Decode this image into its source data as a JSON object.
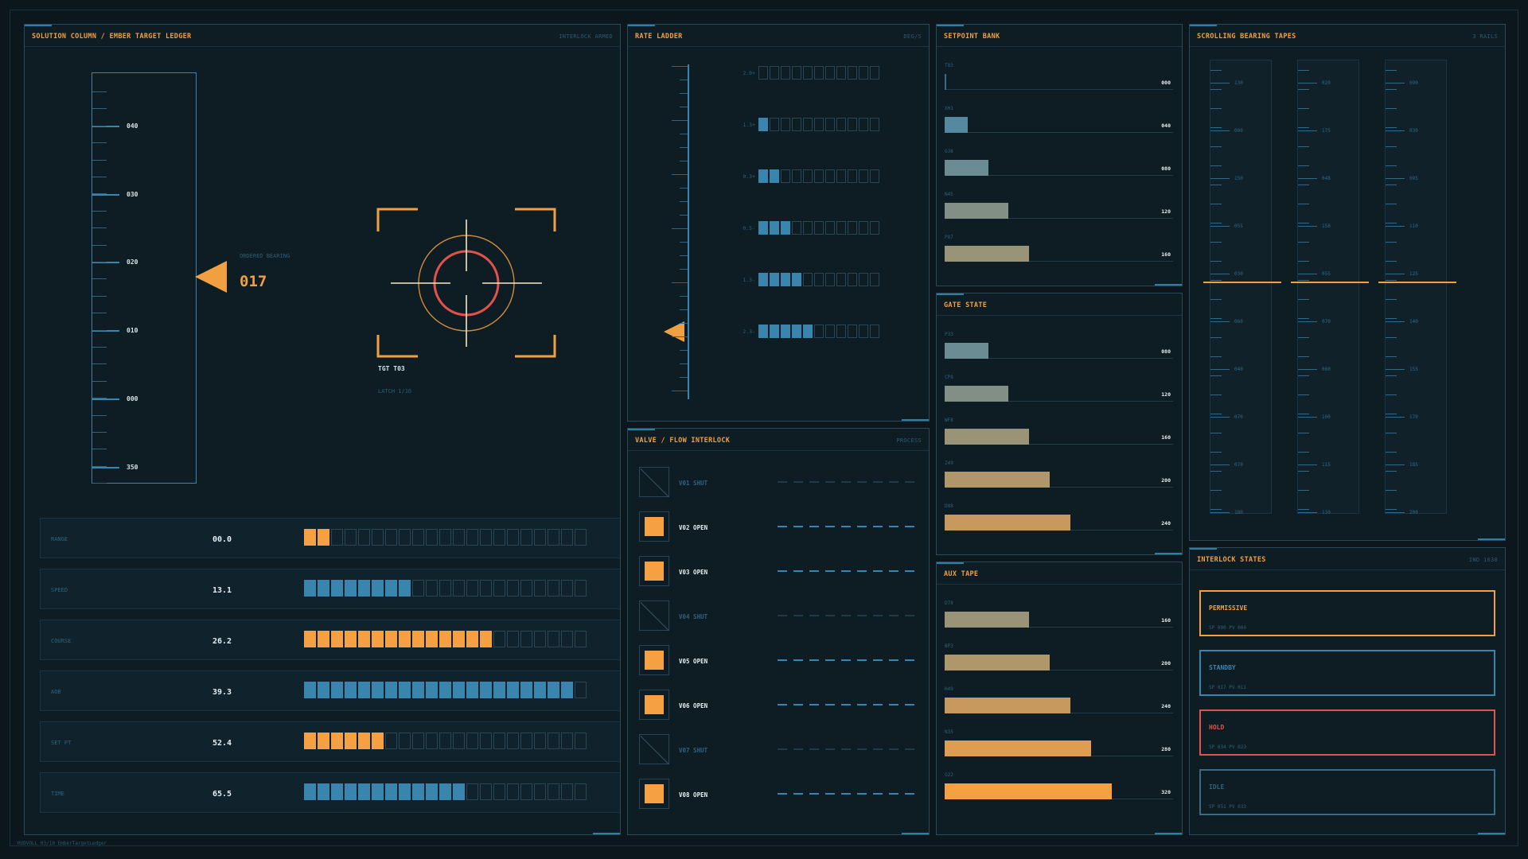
{
  "colors": {
    "accent": "#f0a040",
    "blue": "#3a85ad",
    "red": "#e0524a",
    "bg": "#0b171d"
  },
  "solution": {
    "title": "SOLUTION COLUMN / EMBER TARGET LEDGER",
    "status": "INTERLOCK ARMED",
    "tape_labels": [
      "040",
      "030",
      "020",
      "010",
      "000",
      "350"
    ],
    "ordered_bearing_label": "ORDERED BEARING",
    "ordered_bearing_value": "017",
    "target_label": "TGT T03",
    "latch_label": "LATCH 1/10",
    "metrics": [
      {
        "label": "RANGE",
        "value": "00.0",
        "fill": 2,
        "color": "orange"
      },
      {
        "label": "SPEED",
        "value": "13.1",
        "fill": 8,
        "color": "blue"
      },
      {
        "label": "COURSE",
        "value": "26.2",
        "fill": 14,
        "color": "orange"
      },
      {
        "label": "AOB",
        "value": "39.3",
        "fill": 20,
        "color": "blue"
      },
      {
        "label": "SET PT",
        "value": "52.4",
        "fill": 6,
        "color": "orange"
      },
      {
        "label": "TIME",
        "value": "65.5",
        "fill": 12,
        "color": "blue"
      }
    ]
  },
  "rate": {
    "title": "RATE LADDER",
    "unit": "DEG/S",
    "rows": [
      {
        "label": "+2.0",
        "fill": 0
      },
      {
        "label": "+1.3",
        "fill": 1
      },
      {
        "label": "+0.3",
        "fill": 2
      },
      {
        "label": "-0.5",
        "fill": 3
      },
      {
        "label": "-1.3",
        "fill": 4
      },
      {
        "label": "-2.3",
        "fill": 5
      }
    ]
  },
  "valves": {
    "title": "VALVE / FLOW INTERLOCK",
    "status": "PROCESS",
    "items": [
      {
        "label": "V01 SHUT",
        "open": false
      },
      {
        "label": "V02 OPEN",
        "open": true
      },
      {
        "label": "V03 OPEN",
        "open": true
      },
      {
        "label": "V04 SHUT",
        "open": false
      },
      {
        "label": "V05 OPEN",
        "open": true
      },
      {
        "label": "V06 OPEN",
        "open": true
      },
      {
        "label": "V07 SHUT",
        "open": false
      },
      {
        "label": "V08 OPEN",
        "open": true
      }
    ]
  },
  "setpoint": {
    "title": "SETPOINT BANK",
    "bars": [
      {
        "label": "T83",
        "value": "000",
        "fill": 0.0
      },
      {
        "label": "XH1",
        "value": "040",
        "fill": 0.1
      },
      {
        "label": "G38",
        "value": "080",
        "fill": 0.19
      },
      {
        "label": "N45",
        "value": "120",
        "fill": 0.28
      },
      {
        "label": "P87",
        "value": "160",
        "fill": 0.37
      }
    ]
  },
  "gate": {
    "title": "GATE STATE",
    "bars": [
      {
        "label": "P33",
        "value": "080",
        "fill": 0.19
      },
      {
        "label": "CP8",
        "value": "120",
        "fill": 0.28
      },
      {
        "label": "WF8",
        "value": "160",
        "fill": 0.37
      },
      {
        "label": "Z49",
        "value": "200",
        "fill": 0.46
      },
      {
        "label": "D88",
        "value": "240",
        "fill": 0.55
      }
    ]
  },
  "aux": {
    "title": "AUX TAPE",
    "bars": [
      {
        "label": "D78",
        "value": "160",
        "fill": 0.37
      },
      {
        "label": "BP3",
        "value": "200",
        "fill": 0.46
      },
      {
        "label": "H49",
        "value": "240",
        "fill": 0.55
      },
      {
        "label": "N35",
        "value": "280",
        "fill": 0.64
      },
      {
        "label": "G22",
        "value": "320",
        "fill": 0.73
      }
    ]
  },
  "tapes": {
    "title": "SCROLLING BEARING TAPES",
    "status": "3 RAILS",
    "rails": [
      [
        "130",
        "000",
        "150",
        "055",
        "030",
        "060",
        "040",
        "070",
        "070",
        "180",
        "120",
        "140"
      ],
      [
        "020",
        "175",
        "048",
        "158",
        "055",
        "070",
        "060",
        "100",
        "115",
        "130",
        "141",
        "140"
      ],
      [
        "090",
        "030",
        "095",
        "110",
        "125",
        "140",
        "155",
        "170",
        "185",
        "200",
        "060",
        "215"
      ]
    ]
  },
  "interlock": {
    "title": "INTERLOCK STATES",
    "status": "IND 1630",
    "states": [
      {
        "name": "PERMISSIVE",
        "sub": "SP 000  PV 000",
        "color": "#f0a040"
      },
      {
        "name": "STANDBY",
        "sub": "SP 017  PV 011",
        "color": "#3a85ad"
      },
      {
        "name": "HOLD",
        "sub": "SP 034  PV 023",
        "color": "#e0524a"
      },
      {
        "name": "IDLE",
        "sub": "SP 051  PV 033",
        "color": "#3a6a84"
      }
    ]
  },
  "footer": "HUDVOLL 03/10  EmberTargetLedger"
}
